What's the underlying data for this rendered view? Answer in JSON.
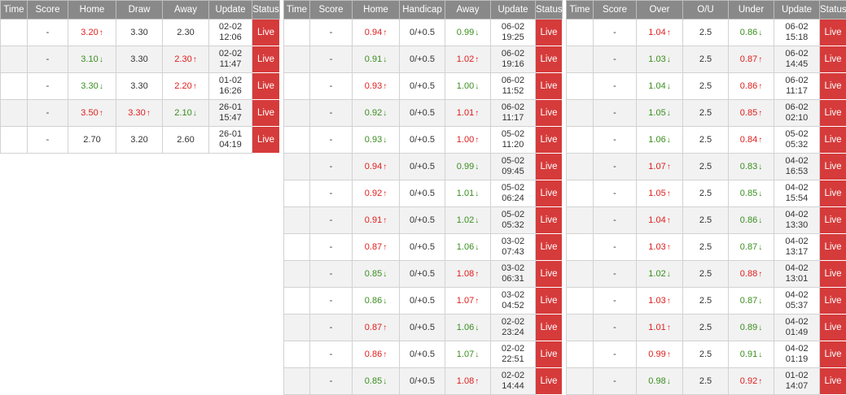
{
  "colors": {
    "header_bg": "#898989",
    "live_bg": "#d63b3b",
    "up": "#e01d1d",
    "down": "#3a8e1f",
    "stripe": "#f2f2f2"
  },
  "tables": [
    {
      "id": "1x2",
      "columns": [
        "Time",
        "Score",
        "Home",
        "Draw",
        "Away",
        "Update",
        "Status"
      ],
      "rows": [
        {
          "time": "",
          "score": "-",
          "home": {
            "v": "3.20",
            "d": "up"
          },
          "mid": {
            "v": "3.30",
            "d": ""
          },
          "away": {
            "v": "2.30",
            "d": ""
          },
          "update": [
            "02-02",
            "12:06"
          ],
          "status": "Live"
        },
        {
          "time": "",
          "score": "-",
          "home": {
            "v": "3.10",
            "d": "down"
          },
          "mid": {
            "v": "3.30",
            "d": ""
          },
          "away": {
            "v": "2.30",
            "d": "up"
          },
          "update": [
            "02-02",
            "11:47"
          ],
          "status": "Live"
        },
        {
          "time": "",
          "score": "-",
          "home": {
            "v": "3.30",
            "d": "down"
          },
          "mid": {
            "v": "3.30",
            "d": ""
          },
          "away": {
            "v": "2.20",
            "d": "up"
          },
          "update": [
            "01-02",
            "16:26"
          ],
          "status": "Live"
        },
        {
          "time": "",
          "score": "-",
          "home": {
            "v": "3.50",
            "d": "up"
          },
          "mid": {
            "v": "3.30",
            "d": "up"
          },
          "away": {
            "v": "2.10",
            "d": "down"
          },
          "update": [
            "26-01",
            "15:47"
          ],
          "status": "Live"
        },
        {
          "time": "",
          "score": "-",
          "home": {
            "v": "2.70",
            "d": ""
          },
          "mid": {
            "v": "3.20",
            "d": ""
          },
          "away": {
            "v": "2.60",
            "d": ""
          },
          "update": [
            "26-01",
            "04:19"
          ],
          "status": "Live"
        }
      ]
    },
    {
      "id": "handicap",
      "columns": [
        "Time",
        "Score",
        "Home",
        "Handicap",
        "Away",
        "Update",
        "Status"
      ],
      "rows": [
        {
          "time": "",
          "score": "-",
          "home": {
            "v": "0.94",
            "d": "up"
          },
          "mid": {
            "v": "0/+0.5",
            "d": ""
          },
          "away": {
            "v": "0.99",
            "d": "down"
          },
          "update": [
            "06-02",
            "19:25"
          ],
          "status": "Live"
        },
        {
          "time": "",
          "score": "-",
          "home": {
            "v": "0.91",
            "d": "down"
          },
          "mid": {
            "v": "0/+0.5",
            "d": ""
          },
          "away": {
            "v": "1.02",
            "d": "up"
          },
          "update": [
            "06-02",
            "19:16"
          ],
          "status": "Live"
        },
        {
          "time": "",
          "score": "-",
          "home": {
            "v": "0.93",
            "d": "up"
          },
          "mid": {
            "v": "0/+0.5",
            "d": ""
          },
          "away": {
            "v": "1.00",
            "d": "down"
          },
          "update": [
            "06-02",
            "11:52"
          ],
          "status": "Live"
        },
        {
          "time": "",
          "score": "-",
          "home": {
            "v": "0.92",
            "d": "down"
          },
          "mid": {
            "v": "0/+0.5",
            "d": ""
          },
          "away": {
            "v": "1.01",
            "d": "up"
          },
          "update": [
            "06-02",
            "11:17"
          ],
          "status": "Live"
        },
        {
          "time": "",
          "score": "-",
          "home": {
            "v": "0.93",
            "d": "down"
          },
          "mid": {
            "v": "0/+0.5",
            "d": ""
          },
          "away": {
            "v": "1.00",
            "d": "up"
          },
          "update": [
            "05-02",
            "11:20"
          ],
          "status": "Live"
        },
        {
          "time": "",
          "score": "-",
          "home": {
            "v": "0.94",
            "d": "up"
          },
          "mid": {
            "v": "0/+0.5",
            "d": ""
          },
          "away": {
            "v": "0.99",
            "d": "down"
          },
          "update": [
            "05-02",
            "09:45"
          ],
          "status": "Live"
        },
        {
          "time": "",
          "score": "-",
          "home": {
            "v": "0.92",
            "d": "up"
          },
          "mid": {
            "v": "0/+0.5",
            "d": ""
          },
          "away": {
            "v": "1.01",
            "d": "down"
          },
          "update": [
            "05-02",
            "06:24"
          ],
          "status": "Live"
        },
        {
          "time": "",
          "score": "-",
          "home": {
            "v": "0.91",
            "d": "up"
          },
          "mid": {
            "v": "0/+0.5",
            "d": ""
          },
          "away": {
            "v": "1.02",
            "d": "down"
          },
          "update": [
            "05-02",
            "05:32"
          ],
          "status": "Live"
        },
        {
          "time": "",
          "score": "-",
          "home": {
            "v": "0.87",
            "d": "up"
          },
          "mid": {
            "v": "0/+0.5",
            "d": ""
          },
          "away": {
            "v": "1.06",
            "d": "down"
          },
          "update": [
            "03-02",
            "07:43"
          ],
          "status": "Live"
        },
        {
          "time": "",
          "score": "-",
          "home": {
            "v": "0.85",
            "d": "down"
          },
          "mid": {
            "v": "0/+0.5",
            "d": ""
          },
          "away": {
            "v": "1.08",
            "d": "up"
          },
          "update": [
            "03-02",
            "06:31"
          ],
          "status": "Live"
        },
        {
          "time": "",
          "score": "-",
          "home": {
            "v": "0.86",
            "d": "down"
          },
          "mid": {
            "v": "0/+0.5",
            "d": ""
          },
          "away": {
            "v": "1.07",
            "d": "up"
          },
          "update": [
            "03-02",
            "04:52"
          ],
          "status": "Live"
        },
        {
          "time": "",
          "score": "-",
          "home": {
            "v": "0.87",
            "d": "up"
          },
          "mid": {
            "v": "0/+0.5",
            "d": ""
          },
          "away": {
            "v": "1.06",
            "d": "down"
          },
          "update": [
            "02-02",
            "23:24"
          ],
          "status": "Live"
        },
        {
          "time": "",
          "score": "-",
          "home": {
            "v": "0.86",
            "d": "up"
          },
          "mid": {
            "v": "0/+0.5",
            "d": ""
          },
          "away": {
            "v": "1.07",
            "d": "down"
          },
          "update": [
            "02-02",
            "22:51"
          ],
          "status": "Live"
        },
        {
          "time": "",
          "score": "-",
          "home": {
            "v": "0.85",
            "d": "down"
          },
          "mid": {
            "v": "0/+0.5",
            "d": ""
          },
          "away": {
            "v": "1.08",
            "d": "up"
          },
          "update": [
            "02-02",
            "14:44"
          ],
          "status": "Live"
        }
      ]
    },
    {
      "id": "over-under",
      "columns": [
        "Time",
        "Score",
        "Over",
        "O/U",
        "Under",
        "Update",
        "Status"
      ],
      "rows": [
        {
          "time": "",
          "score": "-",
          "home": {
            "v": "1.04",
            "d": "up"
          },
          "mid": {
            "v": "2.5",
            "d": ""
          },
          "away": {
            "v": "0.86",
            "d": "down"
          },
          "update": [
            "06-02",
            "15:18"
          ],
          "status": "Live"
        },
        {
          "time": "",
          "score": "-",
          "home": {
            "v": "1.03",
            "d": "down"
          },
          "mid": {
            "v": "2.5",
            "d": ""
          },
          "away": {
            "v": "0.87",
            "d": "up"
          },
          "update": [
            "06-02",
            "14:45"
          ],
          "status": "Live"
        },
        {
          "time": "",
          "score": "-",
          "home": {
            "v": "1.04",
            "d": "down"
          },
          "mid": {
            "v": "2.5",
            "d": ""
          },
          "away": {
            "v": "0.86",
            "d": "up"
          },
          "update": [
            "06-02",
            "11:17"
          ],
          "status": "Live"
        },
        {
          "time": "",
          "score": "-",
          "home": {
            "v": "1.05",
            "d": "down"
          },
          "mid": {
            "v": "2.5",
            "d": ""
          },
          "away": {
            "v": "0.85",
            "d": "up"
          },
          "update": [
            "06-02",
            "02:10"
          ],
          "status": "Live"
        },
        {
          "time": "",
          "score": "-",
          "home": {
            "v": "1.06",
            "d": "down"
          },
          "mid": {
            "v": "2.5",
            "d": ""
          },
          "away": {
            "v": "0.84",
            "d": "up"
          },
          "update": [
            "05-02",
            "05:32"
          ],
          "status": "Live"
        },
        {
          "time": "",
          "score": "-",
          "home": {
            "v": "1.07",
            "d": "up"
          },
          "mid": {
            "v": "2.5",
            "d": ""
          },
          "away": {
            "v": "0.83",
            "d": "down"
          },
          "update": [
            "04-02",
            "16:53"
          ],
          "status": "Live"
        },
        {
          "time": "",
          "score": "-",
          "home": {
            "v": "1.05",
            "d": "up"
          },
          "mid": {
            "v": "2.5",
            "d": ""
          },
          "away": {
            "v": "0.85",
            "d": "down"
          },
          "update": [
            "04-02",
            "15:54"
          ],
          "status": "Live"
        },
        {
          "time": "",
          "score": "-",
          "home": {
            "v": "1.04",
            "d": "up"
          },
          "mid": {
            "v": "2.5",
            "d": ""
          },
          "away": {
            "v": "0.86",
            "d": "down"
          },
          "update": [
            "04-02",
            "13:30"
          ],
          "status": "Live"
        },
        {
          "time": "",
          "score": "-",
          "home": {
            "v": "1.03",
            "d": "up"
          },
          "mid": {
            "v": "2.5",
            "d": ""
          },
          "away": {
            "v": "0.87",
            "d": "down"
          },
          "update": [
            "04-02",
            "13:17"
          ],
          "status": "Live"
        },
        {
          "time": "",
          "score": "-",
          "home": {
            "v": "1.02",
            "d": "down"
          },
          "mid": {
            "v": "2.5",
            "d": ""
          },
          "away": {
            "v": "0.88",
            "d": "up"
          },
          "update": [
            "04-02",
            "13:01"
          ],
          "status": "Live"
        },
        {
          "time": "",
          "score": "-",
          "home": {
            "v": "1.03",
            "d": "up"
          },
          "mid": {
            "v": "2.5",
            "d": ""
          },
          "away": {
            "v": "0.87",
            "d": "down"
          },
          "update": [
            "04-02",
            "05:37"
          ],
          "status": "Live"
        },
        {
          "time": "",
          "score": "-",
          "home": {
            "v": "1.01",
            "d": "up"
          },
          "mid": {
            "v": "2.5",
            "d": ""
          },
          "away": {
            "v": "0.89",
            "d": "down"
          },
          "update": [
            "04-02",
            "01:49"
          ],
          "status": "Live"
        },
        {
          "time": "",
          "score": "-",
          "home": {
            "v": "0.99",
            "d": "up"
          },
          "mid": {
            "v": "2.5",
            "d": ""
          },
          "away": {
            "v": "0.91",
            "d": "down"
          },
          "update": [
            "04-02",
            "01:19"
          ],
          "status": "Live"
        },
        {
          "time": "",
          "score": "-",
          "home": {
            "v": "0.98",
            "d": "down"
          },
          "mid": {
            "v": "2.5",
            "d": ""
          },
          "away": {
            "v": "0.92",
            "d": "up"
          },
          "update": [
            "01-02",
            "14:07"
          ],
          "status": "Live"
        }
      ]
    }
  ]
}
